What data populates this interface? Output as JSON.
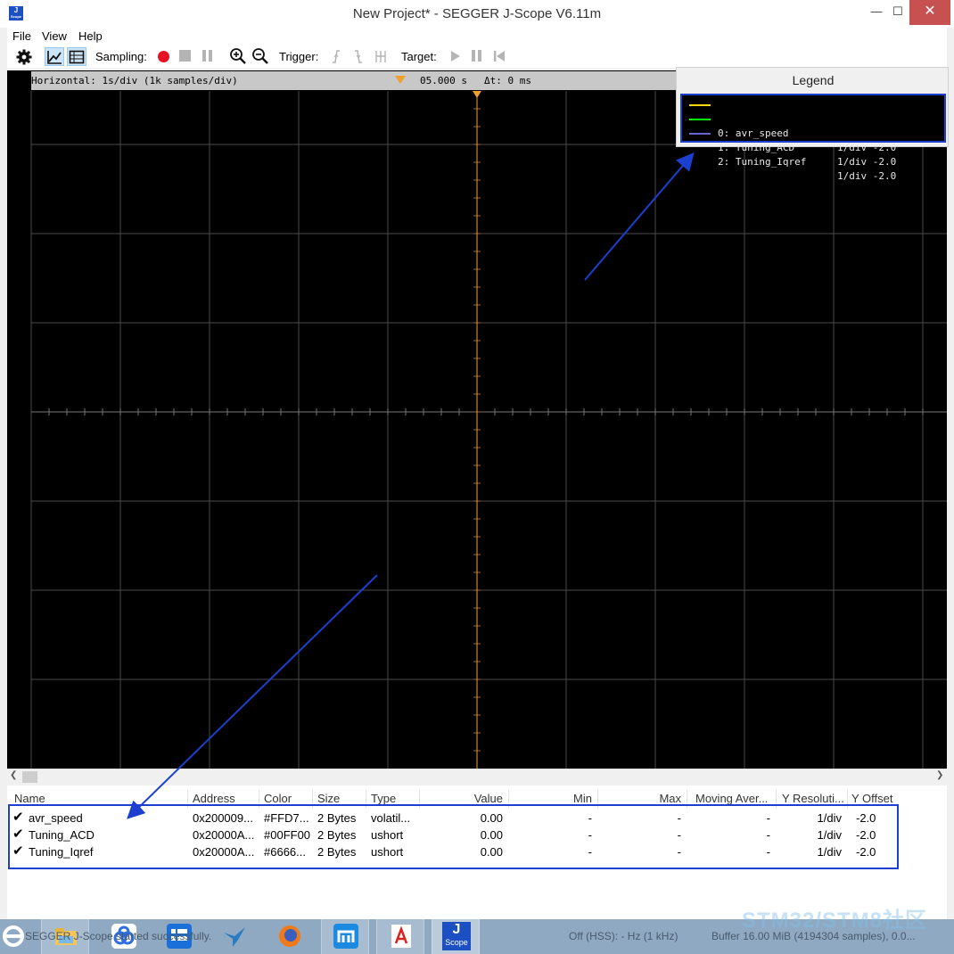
{
  "window": {
    "title": "New Project* - SEGGER J-Scope V6.11m",
    "icon_label": "J",
    "icon_sub": "Scope"
  },
  "menu": [
    "File",
    "View",
    "Help"
  ],
  "toolbar": {
    "sampling_label": "Sampling:",
    "trigger_label": "Trigger:",
    "target_label": "Target:",
    "record_color": "#e81123"
  },
  "scope": {
    "horizontal": "Horizontal: 1s/div (1k samples/div)",
    "trigger_time": "05.000 s",
    "delta": "Δt: 0 ms",
    "background": "#000000",
    "grid_color": "#4a4a4a",
    "cursor_color": "#f0a030"
  },
  "legend": {
    "title": "Legend",
    "entries": [
      {
        "label": "0: avr_speed",
        "res": "1/div -2.0",
        "color": "#FFD700"
      },
      {
        "label": "1: Tuning_ACD",
        "res": "1/div -2.0",
        "color": "#00FF00"
      },
      {
        "label": "2: Tuning_Iqref",
        "res": "1/div -2.0",
        "color": "#6666CC"
      }
    ]
  },
  "table": {
    "headers": [
      "Name",
      "Address",
      "Color",
      "Size",
      "Type",
      "Value",
      "Min",
      "Max",
      "Moving Aver...",
      "Y Resoluti...",
      "Y Offset"
    ],
    "rows": [
      [
        "avr_speed",
        "0x200009...",
        "#FFD7...",
        "2 Bytes",
        "volatil...",
        "0.00",
        "-",
        "-",
        "-",
        "1/div",
        "-2.0"
      ],
      [
        "Tuning_ACD",
        "0x20000A...",
        "#00FF00",
        "2 Bytes",
        "ushort",
        "0.00",
        "-",
        "-",
        "-",
        "1/div",
        "-2.0"
      ],
      [
        "Tuning_Iqref",
        "0x20000A...",
        "#6666...",
        "2 Bytes",
        "ushort",
        "0.00",
        "-",
        "-",
        "-",
        "1/div",
        "-2.0"
      ]
    ]
  },
  "status": {
    "left": "SEGGER J-Scope started successfully.",
    "mid": "Off (HSS): - Hz (1 kHz)",
    "right": "Buffer 16.00 MiB (4194304 samples), 0.0..."
  },
  "watermark": "STM32/STM8社区",
  "taskbar": {
    "jscope_label": "J",
    "jscope_sub": "Scope"
  },
  "annotation_color": "#1d3fd0"
}
